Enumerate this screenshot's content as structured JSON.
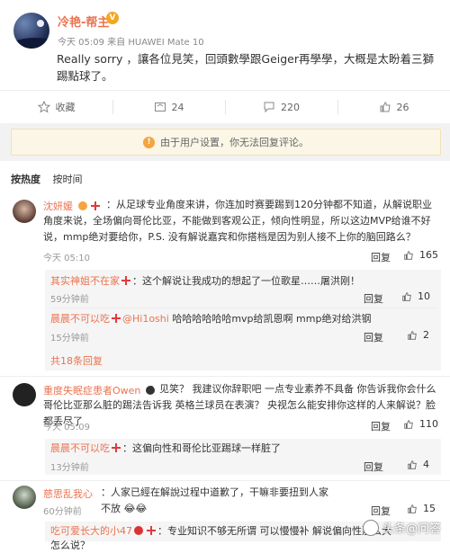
{
  "post": {
    "username": "冷艳-帮主",
    "verified_badge": "V",
    "meta": "今天 05:09 来自 HUAWEI Mate 10",
    "text": "Really sorry ，讓各位見笑，回頭數學跟Geiger再學學，大概是太盼着三獅踢點球了。"
  },
  "actions": {
    "favorite": "收藏",
    "repost": "24",
    "comment": "220",
    "like": "26"
  },
  "notice": "由于用户设置，你无法回复评论。",
  "sort": {
    "hot": "按热度",
    "time": "按时间"
  },
  "comments": [
    {
      "name": "沈妍媛",
      "text": "：从足球专业角度来讲，你连加时赛要踢到120分钟都不知道，从解说职业角度来说，全场偏向哥伦比亚，不能做到客观公正，倾向性明显，所以这边MVP给谁不好说，mmp绝对要给你，P.S. 没有解说嘉宾和你搭档是因为别人接不上你的脑回路么？",
      "time": "今天 05:10",
      "reply": "回复",
      "likes": "165",
      "replies": [
        {
          "name": "其实神姐不在家",
          "text": "：这个解说让我成功的想起了一位歌星……屠洪刚！",
          "time": "59分钟前",
          "reply": "回复",
          "likes": "10"
        },
        {
          "name": "晨晨不可以吃",
          "mention": "@Hi1oshi",
          "text": " 哈哈哈哈哈哈mvp给凯恩啊 mmp绝对给洪钢",
          "time": "15分钟前",
          "reply": "回复",
          "likes": "2"
        }
      ],
      "more": "共18条回复"
    },
    {
      "name": "重度失眠症患者Owen",
      "text": "：见笑？ 我建议你辞职吧 一点专业素养不具备 你告诉我你会什么 哥伦比亚那么脏的踢法告诉我 英格兰球员在表演？ 央视怎么能安排你这样的人来解说？脸都丢尽了",
      "time": "今天 05:09",
      "reply": "回复",
      "likes": "110",
      "replies": [
        {
          "name": "晨晨不可以吃",
          "text": "：这偏向性和哥伦比亚踢球一样脏了",
          "time": "13分钟前",
          "reply": "回复",
          "likes": "4"
        }
      ]
    },
    {
      "name": "慈思乱我心",
      "text": "：人家已經在解說过程中道歉了，干嘛非要扭到人家不放",
      "time": "60分钟前",
      "reply": "回复",
      "likes": "15",
      "replies": [
        {
          "name": "吃可爱长大的小47",
          "text": "：专业知识不够无所谓 可以慢慢补 解说偏向性那么大怎么说？",
          "time": "",
          "reply": "",
          "likes": ""
        }
      ]
    }
  ],
  "watermark": "头条@问答",
  "colors": {
    "accent": "#eb7350",
    "notice_bg": "#fbf6e6",
    "reply_bg": "#f5f5f5"
  }
}
